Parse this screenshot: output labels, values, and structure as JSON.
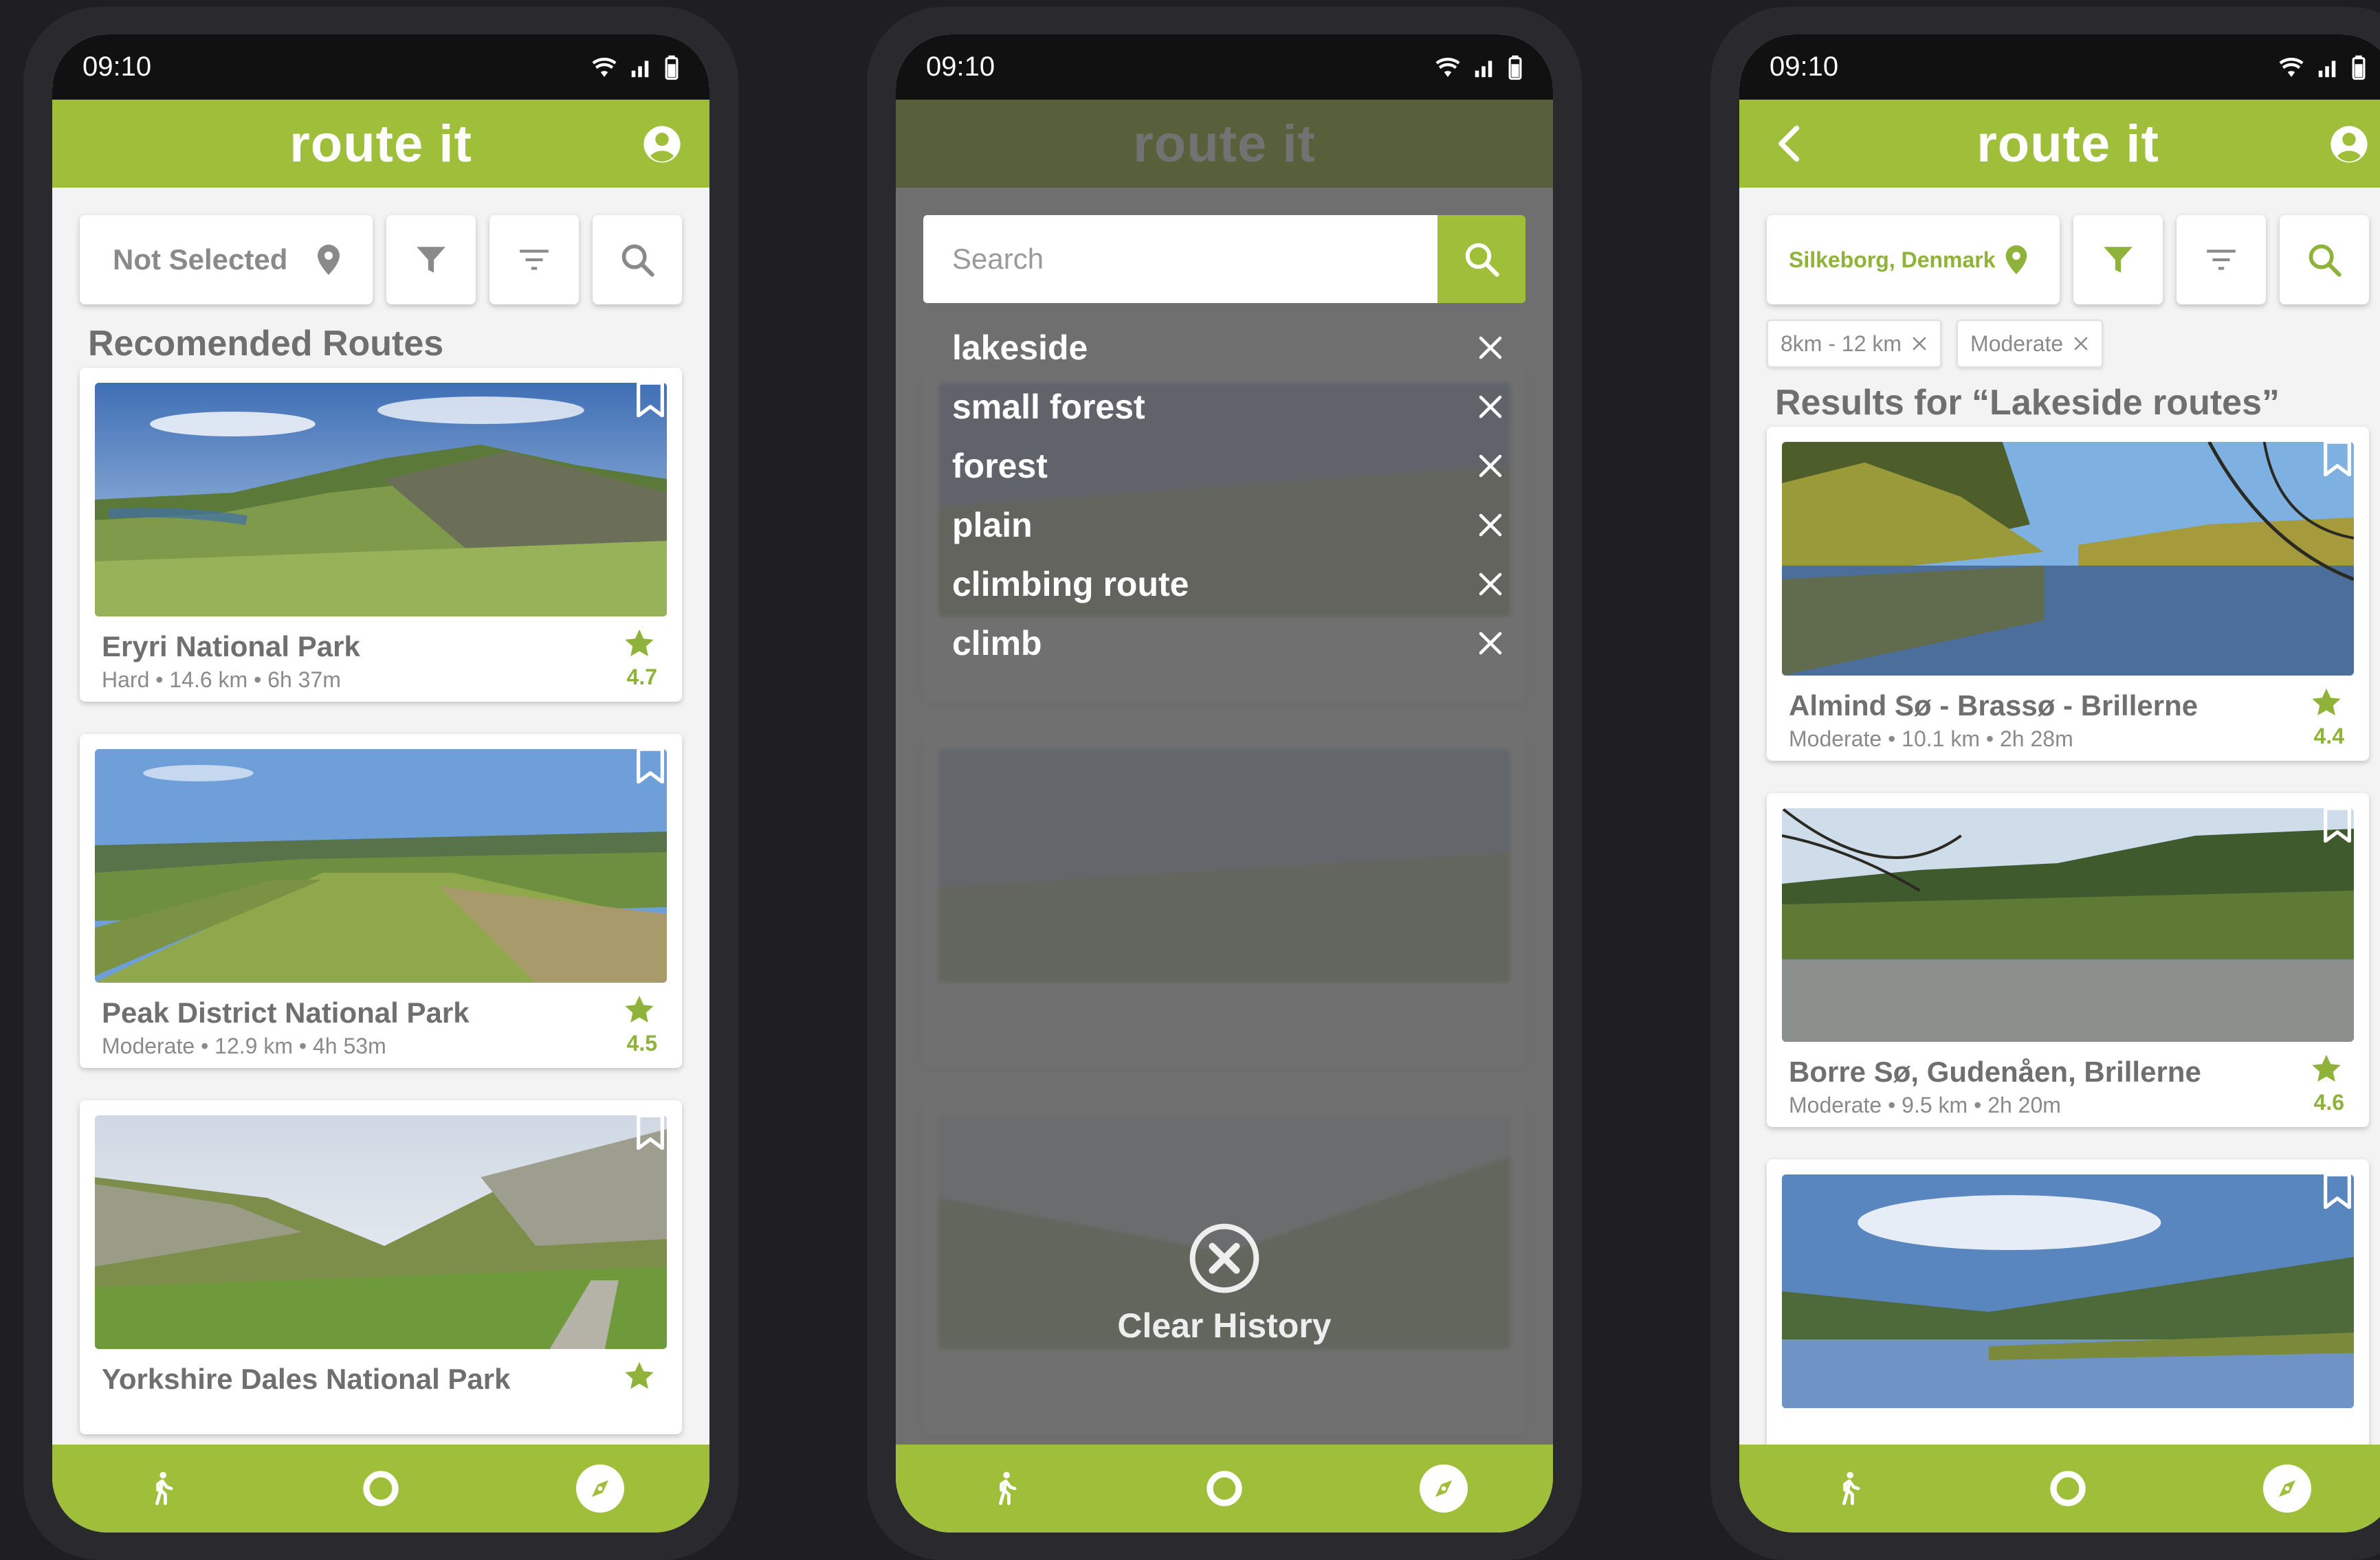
{
  "colors": {
    "accent": "#9fbf3b",
    "accent_text": "#8fb33a",
    "status_bar": "#111111",
    "background": "#1f1f23"
  },
  "status": {
    "time": "09:10"
  },
  "app": {
    "brand": "route it"
  },
  "screen1": {
    "location": "Not Selected",
    "section_title": "Recomended Routes",
    "routes": [
      {
        "name": "Eryri National Park",
        "meta": "Hard • 14.6 km • 6h 37m",
        "rating": "4.7"
      },
      {
        "name": "Peak District National Park",
        "meta": "Moderate • 12.9 km • 4h 53m",
        "rating": "4.5"
      },
      {
        "name": "Yorkshire Dales National Park",
        "meta": "",
        "rating": ""
      }
    ]
  },
  "screen2": {
    "search_placeholder": "Search",
    "history": [
      "lakeside",
      "small forest",
      "forest",
      "plain",
      "climbing route",
      "climb"
    ],
    "clear_label": "Clear History"
  },
  "screen3": {
    "location": "Silkeborg, Denmark",
    "chips": [
      "8km - 12 km",
      "Moderate"
    ],
    "section_title": "Results for “Lakeside routes”",
    "routes": [
      {
        "name": "Almind Sø - Brassø - Brillerne",
        "meta": "Moderate • 10.1 km • 2h 28m",
        "rating": "4.4"
      },
      {
        "name": "Borre Sø, Gudenåen, Brillerne",
        "meta": "Moderate • 9.5 km • 2h 20m",
        "rating": "4.6"
      }
    ]
  },
  "icons": {
    "profile": "user-circle-icon",
    "location": "map-pin-icon",
    "filter": "funnel-icon",
    "sort": "sort-lines-icon",
    "search": "magnifier-icon",
    "bookmark": "bookmark-icon",
    "star": "star-icon",
    "walk": "walking-person-icon",
    "record": "record-circle-icon",
    "explore": "compass-icon",
    "close": "x-icon",
    "back": "chevron-left-icon"
  }
}
